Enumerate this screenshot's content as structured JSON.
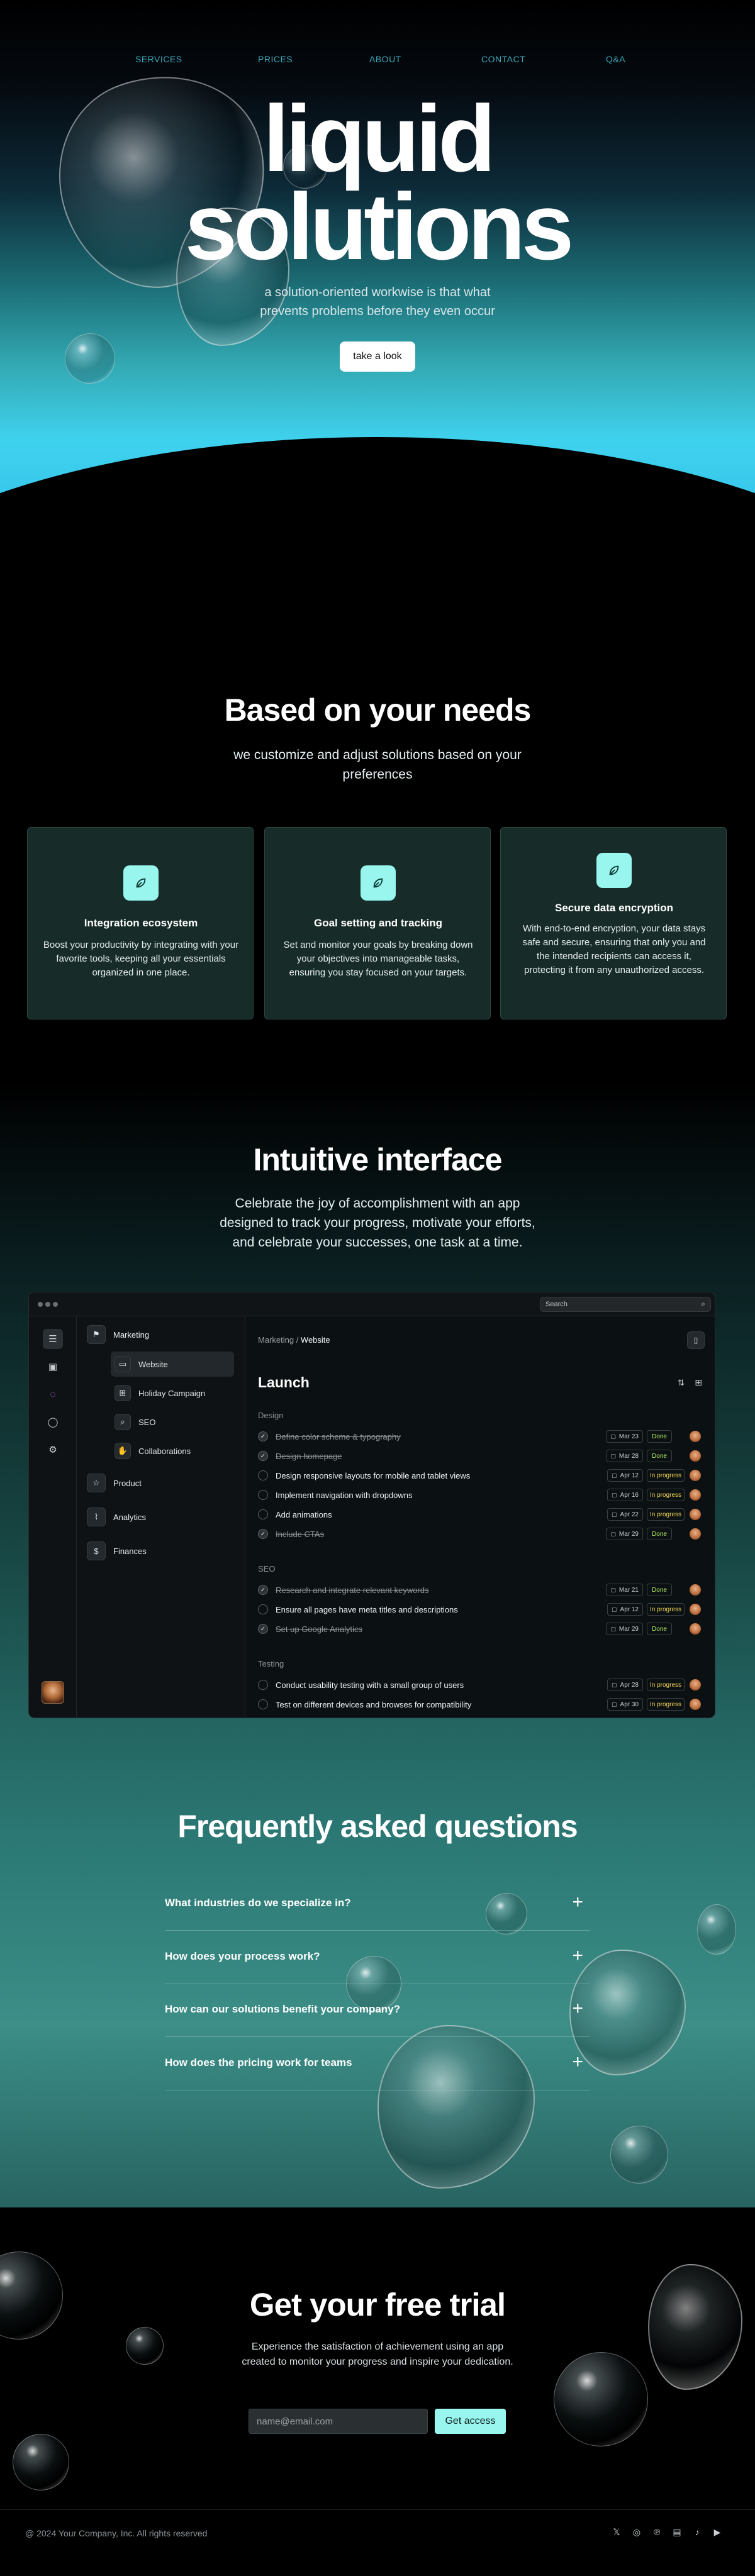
{
  "nav": {
    "items": [
      "SERVICES",
      "PRICES",
      "ABOUT",
      "CONTACT",
      "Q&A"
    ]
  },
  "hero": {
    "title_line1": "liquid",
    "title_line2": "solutions",
    "subtitle_line1": "a solution-oriented workwise is that what",
    "subtitle_line2": "prevents problems before they even occur",
    "cta": "take a look"
  },
  "needs": {
    "title": "Based on your needs",
    "subtitle_line1": "we customize and adjust solutions based on your",
    "subtitle_line2": "preferences",
    "cards": [
      {
        "icon": "leaf-icon",
        "title": "Integration ecosystem",
        "description": "Boost your productivity by integrating with your favorite tools, keeping all your essentials organized in one place."
      },
      {
        "icon": "leaf-icon",
        "title": "Goal setting and tracking",
        "description": "Set and monitor your goals by breaking down your objectives into manageable tasks, ensuring you stay focused on your targets."
      },
      {
        "icon": "leaf-icon",
        "title": "Secure data encryption",
        "description": "With end-to-end encryption, your data stays safe and secure, ensuring that only you and the intended recipients can access it, protecting it from any unauthorized access."
      }
    ]
  },
  "interface": {
    "title": "Intuitive interface",
    "subtitle_line1": "Celebrate the joy of accomplishment with an app",
    "subtitle_line2": "designed to track your progress, motivate your efforts,",
    "subtitle_line3": "and celebrate your successes, one task at a time."
  },
  "app": {
    "search_placeholder": "Search",
    "sidebar": {
      "marketing": "Marketing",
      "sub_items": [
        "Website",
        "Holiday Campaign",
        "SEO",
        "Collaborations"
      ],
      "product": "Product",
      "analytics": "Analytics",
      "finances": "Finances"
    },
    "breadcrumb_parent": "Marketing",
    "breadcrumb_sep": " / ",
    "breadcrumb_current": "Website",
    "page_title": "Launch",
    "groups": [
      {
        "label": "Design",
        "tasks": [
          {
            "name": "Define color scheme & typography",
            "date": "Mar 23",
            "status": "Done",
            "done": true
          },
          {
            "name": "Design homepage",
            "date": "Mar 28",
            "status": "Done",
            "done": true
          },
          {
            "name": "Design responsive layouts for mobile and tablet views",
            "date": "Apr 12",
            "status": "In progress",
            "done": false
          },
          {
            "name": "Implement navigation with dropdowns",
            "date": "Apr 16",
            "status": "In progress",
            "done": false
          },
          {
            "name": "Add animations",
            "date": "Apr 22",
            "status": "In progress",
            "done": false
          },
          {
            "name": "Include CTAs",
            "date": "Mar 29",
            "status": "Done",
            "done": true
          }
        ]
      },
      {
        "label": "SEO",
        "tasks": [
          {
            "name": "Research and integrate relevant keywords",
            "date": "Mar 21",
            "status": "Done",
            "done": true
          },
          {
            "name": "Ensure all pages have meta titles and descriptions",
            "date": "Apr 12",
            "status": "In progress",
            "done": false
          },
          {
            "name": "Set up Google Analytics",
            "date": "Mar 29",
            "status": "Done",
            "done": true
          }
        ]
      },
      {
        "label": "Testing",
        "tasks": [
          {
            "name": "Conduct usability testing with a small group of users",
            "date": "Apr 28",
            "status": "In progress",
            "done": false
          },
          {
            "name": "Test on different devices and browses for compatibility",
            "date": "Apr 30",
            "status": "In progress",
            "done": false
          }
        ]
      }
    ]
  },
  "faq": {
    "title": "Frequently asked questions",
    "questions": [
      "What industries do we specialize in?",
      "How does your process work?",
      "How can our solutions benefit your company?",
      "How does the pricing work for teams"
    ],
    "expand_symbol": "+"
  },
  "trial": {
    "title": "Get your free trial",
    "subtitle": "Experience the satisfaction of achievement using an app created to monitor your progress and inspire your dedication.",
    "email_placeholder": "name@email.com",
    "cta": "Get access"
  },
  "footer": {
    "copyright": "@ 2024 Your Company, Inc. All rights reserved",
    "social": [
      "x-icon",
      "instagram-icon",
      "pinterest-icon",
      "linkedin-icon",
      "tiktok-icon",
      "youtube-icon"
    ]
  },
  "colors": {
    "accent": "#98f6ee",
    "card_bg": "#172c29",
    "status_done": "#b6f064",
    "status_progress": "#f0d457"
  }
}
